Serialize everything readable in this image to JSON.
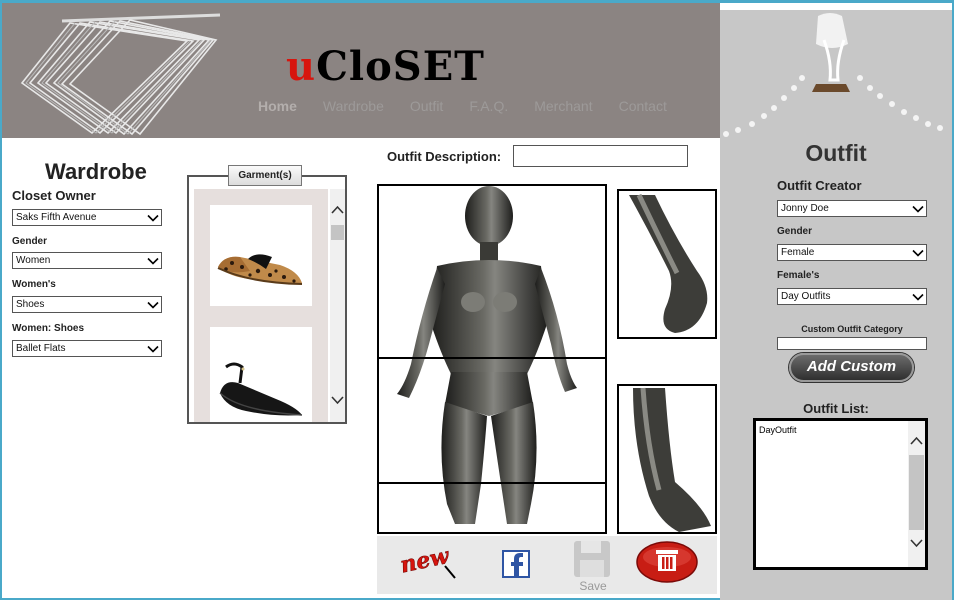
{
  "header": {
    "logo_first": "u",
    "logo_rest": "CloSET",
    "nav": [
      "Home",
      "Wardrobe",
      "Outfit",
      "F.A.Q.",
      "Merchant",
      "Contact"
    ],
    "nav_active": "Home"
  },
  "wardrobe": {
    "title": "Wardrobe",
    "closet_owner_label": "Closet Owner",
    "closet_owner_value": "Saks Fifth Avenue",
    "gender_label": "Gender",
    "gender_value": "Women",
    "category_label": "Women's",
    "category_value": "Shoes",
    "subcategory_label": "Women: Shoes",
    "subcategory_value": "Ballet Flats",
    "garment_button": "Garment(s)"
  },
  "outfit_description": {
    "label": "Outfit Description:",
    "value": ""
  },
  "toolbar": {
    "save_label": "Save"
  },
  "outfit_panel": {
    "title": "Outfit",
    "creator_label": "Outfit Creator",
    "creator_value": "Jonny Doe",
    "gender_label": "Gender",
    "gender_value": "Female",
    "category_label": "Female's",
    "category_value": "Day Outfits",
    "custom_label": "Custom Outfit Category",
    "custom_value": "",
    "add_custom_button": "Add Custom",
    "list_label": "Outfit List:",
    "list_items": [
      "DayOutfit"
    ]
  },
  "colors": {
    "header_bg": "#8b8482",
    "panel_bg": "#c7c7c7",
    "logo_red": "#d7150e",
    "annotation_arrow": "#e02020",
    "window_border": "#4aa9c9"
  }
}
